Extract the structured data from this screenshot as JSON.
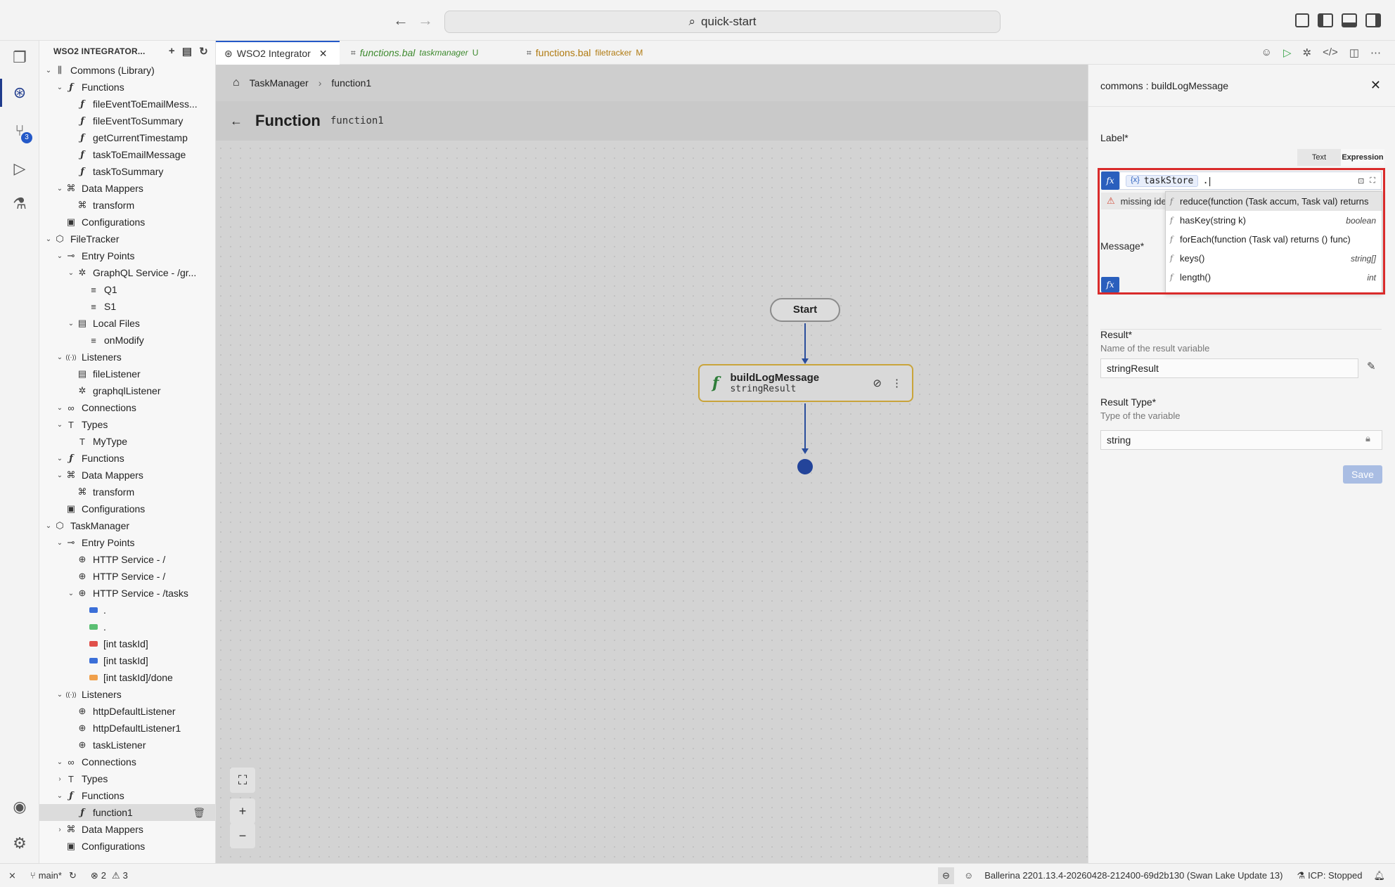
{
  "titlebar": {
    "search_text": "quick-start"
  },
  "activity": {
    "source_control_badge": "3"
  },
  "sidebar": {
    "title": "WSO2 INTEGRATOR...",
    "tree": [
      {
        "label": "Commons (Library)",
        "depth": 0,
        "chevron": "down",
        "icon": "library"
      },
      {
        "label": "Functions",
        "depth": 1,
        "chevron": "down",
        "icon": "fn"
      },
      {
        "label": "fileEventToEmailMess...",
        "depth": 2,
        "icon": "fn"
      },
      {
        "label": "fileEventToSummary",
        "depth": 2,
        "icon": "fn"
      },
      {
        "label": "getCurrentTimestamp",
        "depth": 2,
        "icon": "fn"
      },
      {
        "label": "taskToEmailMessage",
        "depth": 2,
        "icon": "fn"
      },
      {
        "label": "taskToSummary",
        "depth": 2,
        "icon": "fn"
      },
      {
        "label": "Data Mappers",
        "depth": 1,
        "chevron": "down",
        "icon": "mapper"
      },
      {
        "label": "transform",
        "depth": 2,
        "icon": "mapper"
      },
      {
        "label": "Configurations",
        "depth": 1,
        "icon": "config"
      },
      {
        "label": "FileTracker",
        "depth": 0,
        "chevron": "down",
        "icon": "package"
      },
      {
        "label": "Entry Points",
        "depth": 1,
        "chevron": "down",
        "icon": "entry"
      },
      {
        "label": "GraphQL Service - /gr...",
        "depth": 2,
        "chevron": "down",
        "icon": "graphql"
      },
      {
        "label": "Q1",
        "depth": 3,
        "icon": "resource"
      },
      {
        "label": "S1",
        "depth": 3,
        "icon": "resource"
      },
      {
        "label": "Local Files",
        "depth": 2,
        "chevron": "down",
        "icon": "file"
      },
      {
        "label": "onModify",
        "depth": 3,
        "icon": "resource"
      },
      {
        "label": "Listeners",
        "depth": 1,
        "chevron": "down",
        "icon": "listener"
      },
      {
        "label": "fileListener",
        "depth": 2,
        "icon": "file"
      },
      {
        "label": "graphqlListener",
        "depth": 2,
        "icon": "graphql"
      },
      {
        "label": "Connections",
        "depth": 1,
        "chevron": "right-open",
        "icon": "link"
      },
      {
        "label": "Types",
        "depth": 1,
        "chevron": "down",
        "icon": "type"
      },
      {
        "label": "MyType",
        "depth": 2,
        "icon": "type"
      },
      {
        "label": "Functions",
        "depth": 1,
        "chevron": "down",
        "icon": "fn"
      },
      {
        "label": "Data Mappers",
        "depth": 1,
        "chevron": "down",
        "icon": "mapper"
      },
      {
        "label": "transform",
        "depth": 2,
        "icon": "mapper"
      },
      {
        "label": "Configurations",
        "depth": 1,
        "icon": "config"
      },
      {
        "label": "TaskManager",
        "depth": 0,
        "chevron": "down",
        "icon": "package"
      },
      {
        "label": "Entry Points",
        "depth": 1,
        "chevron": "down",
        "icon": "entry"
      },
      {
        "label": "HTTP Service - /",
        "depth": 2,
        "icon": "globe"
      },
      {
        "label": "HTTP Service - /",
        "depth": 2,
        "icon": "globe"
      },
      {
        "label": "HTTP Service - /tasks",
        "depth": 2,
        "chevron": "down",
        "icon": "globe"
      },
      {
        "label": ".",
        "depth": 3,
        "method": "#3b6fd8"
      },
      {
        "label": ".",
        "depth": 3,
        "method": "#5bbf73"
      },
      {
        "label": "[int taskId]",
        "depth": 3,
        "method": "#e0504a"
      },
      {
        "label": "[int taskId]",
        "depth": 3,
        "method": "#3b6fd8"
      },
      {
        "label": "[int taskId]/done",
        "depth": 3,
        "method": "#f0a04b"
      },
      {
        "label": "Listeners",
        "depth": 1,
        "chevron": "down",
        "icon": "listener"
      },
      {
        "label": "httpDefaultListener",
        "depth": 2,
        "icon": "globe"
      },
      {
        "label": "httpDefaultListener1",
        "depth": 2,
        "icon": "globe"
      },
      {
        "label": "taskListener",
        "depth": 2,
        "icon": "globe"
      },
      {
        "label": "Connections",
        "depth": 1,
        "chevron": "down",
        "icon": "link"
      },
      {
        "label": "Types",
        "depth": 1,
        "chevron": "right",
        "icon": "type"
      },
      {
        "label": "Functions",
        "depth": 1,
        "chevron": "down",
        "icon": "fn"
      },
      {
        "label": "function1",
        "depth": 2,
        "icon": "fn",
        "selected": true
      },
      {
        "label": "Data Mappers",
        "depth": 1,
        "chevron": "right",
        "icon": "mapper"
      },
      {
        "label": "Configurations",
        "depth": 1,
        "icon": "config"
      }
    ]
  },
  "tabs": [
    {
      "label": "WSO2 Integrator",
      "sub": "",
      "active": true,
      "color": "#333333"
    },
    {
      "label": "functions.bal",
      "sub": "taskmanager",
      "status": "U",
      "active": false,
      "color": "#3e8a2f"
    },
    {
      "label": "functions.bal",
      "sub": "filetracker",
      "status": "M",
      "active": false,
      "color": "#b07a10"
    }
  ],
  "canvas": {
    "breadcrumb": [
      "TaskManager",
      "function1"
    ],
    "header_title": "Function",
    "header_name": "function1",
    "start_label": "Start",
    "node_title": "buildLogMessage",
    "node_subtitle": "stringResult",
    "zoom_in": "+",
    "zoom_out": "−"
  },
  "panel": {
    "header": "commons : buildLogMessage",
    "label_title": "Label*",
    "mode_text": "Text",
    "mode_expression": "Expression",
    "chip_icon": "{x}",
    "chip_text": "taskStore",
    "expr_suffix": ".",
    "error_text": "missing identifier",
    "message_title": "Message*",
    "fx_text": "fx",
    "completions": [
      {
        "label": "reduce(function (Task accum, Task val) returns",
        "type": ""
      },
      {
        "label": "hasKey(string k)",
        "type": "boolean"
      },
      {
        "label": "forEach(function (Task val) returns () func)",
        "type": ""
      },
      {
        "label": "keys()",
        "type": "string[]"
      },
      {
        "label": "length()",
        "type": "int"
      }
    ],
    "result_title": "Result*",
    "result_sub": "Name of the result variable",
    "result_value": "stringResult",
    "result_type_title": "Result Type*",
    "result_type_sub": "Type of the variable",
    "result_type_value": "string",
    "save_label": "Save",
    "highlight_color": "#d92b2b"
  },
  "statusbar": {
    "branch": "main*",
    "errors": "2",
    "warnings": "3",
    "version": "Ballerina 2201.13.4-20260428-212400-69d2b130 (Swan Lake Update 13)",
    "icp": "ICP: Stopped"
  }
}
